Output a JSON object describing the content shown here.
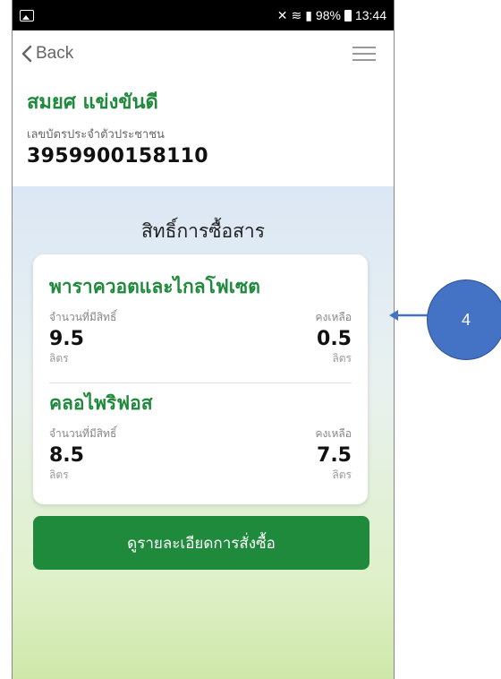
{
  "statusbar": {
    "signal_text": "98%",
    "time": "13:44"
  },
  "nav": {
    "back_label": "Back"
  },
  "profile": {
    "name": "สมยศ แข่งขันดี",
    "id_label": "เลขบัตรประจำตัวประชาชน",
    "id_number": "3959900158110"
  },
  "section": {
    "title": "สิทธิ์การซื้อสาร"
  },
  "products": [
    {
      "name": "พาราควอตและไกลโฟเซต",
      "entitled_label": "จำนวนที่มีสิทธิ์",
      "remaining_label": "คงเหลือ",
      "entitled_value": "9.5",
      "remaining_value": "0.5",
      "unit_left": "ลิตร",
      "unit_right": "ลิตร"
    },
    {
      "name": "คลอไพริฟอส",
      "entitled_label": "จำนวนที่มีสิทธิ์",
      "remaining_label": "คงเหลือ",
      "entitled_value": "8.5",
      "remaining_value": "7.5",
      "unit_left": "ลิตร",
      "unit_right": "ลิตร"
    }
  ],
  "cta": {
    "label": "ดูรายละเอียดการสั่งซื้อ"
  },
  "annotation": {
    "number": "4"
  },
  "colors": {
    "brand_green": "#1f8a3b",
    "callout_blue": "#4472c4"
  }
}
